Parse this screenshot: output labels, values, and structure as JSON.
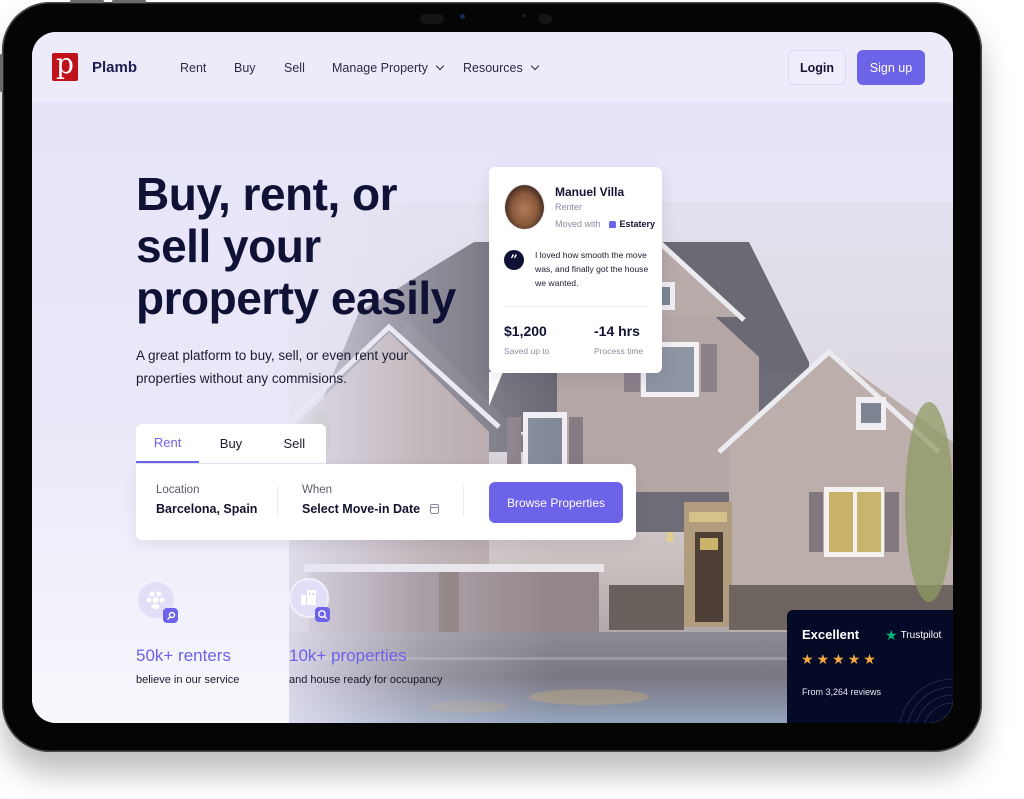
{
  "nav": {
    "logo_letter": "p",
    "brand": "Plamb",
    "links": [
      {
        "label": "Rent",
        "dropdown": false
      },
      {
        "label": "Buy",
        "dropdown": false
      },
      {
        "label": "Sell",
        "dropdown": false
      },
      {
        "label": "Manage Property",
        "dropdown": true
      },
      {
        "label": "Resources",
        "dropdown": true
      }
    ],
    "login": "Login",
    "signup": "Sign up"
  },
  "hero": {
    "headline": "Buy, rent, or sell your property easily",
    "subtext": "A great platform to buy, sell, or even rent your properties without any commisions."
  },
  "search": {
    "tabs": [
      {
        "label": "Rent",
        "active": true
      },
      {
        "label": "Buy",
        "active": false
      },
      {
        "label": "Sell",
        "active": false
      }
    ],
    "location_label": "Location",
    "location_value": "Barcelona, Spain",
    "when_label": "When",
    "when_value": "Select Move-in Date",
    "browse_button": "Browse Properties"
  },
  "testimonial": {
    "name": "Manuel Villa",
    "role": "Renter",
    "moved_with_label": "Moved with",
    "company": "Estatery",
    "quote_mark": "”",
    "quote": "I loved how smooth the move was, and finally got the house we wanted.",
    "stats": [
      {
        "value": "$1,200",
        "label": "Saved up to"
      },
      {
        "value": "-14 hrs",
        "label": "Process time"
      }
    ]
  },
  "features": [
    {
      "title": "50k+ renters",
      "subtitle": "believe in our service",
      "icon": "users-icon",
      "badge_icon": "key-icon"
    },
    {
      "title": "10k+ properties",
      "subtitle": "and house ready for occupancy",
      "icon": "buildings-icon",
      "badge_icon": "search-icon"
    }
  ],
  "trustpilot": {
    "rating_label": "Excellent",
    "brand": "Trustpilot",
    "stars": 5,
    "reviews": "From 3,264 reviews"
  },
  "colors": {
    "accent": "#6c63e9",
    "dark_navy": "#0f1135",
    "logo_red": "#c0121b",
    "trustpilot_green": "#00b67a",
    "star_orange": "#f7a740"
  }
}
